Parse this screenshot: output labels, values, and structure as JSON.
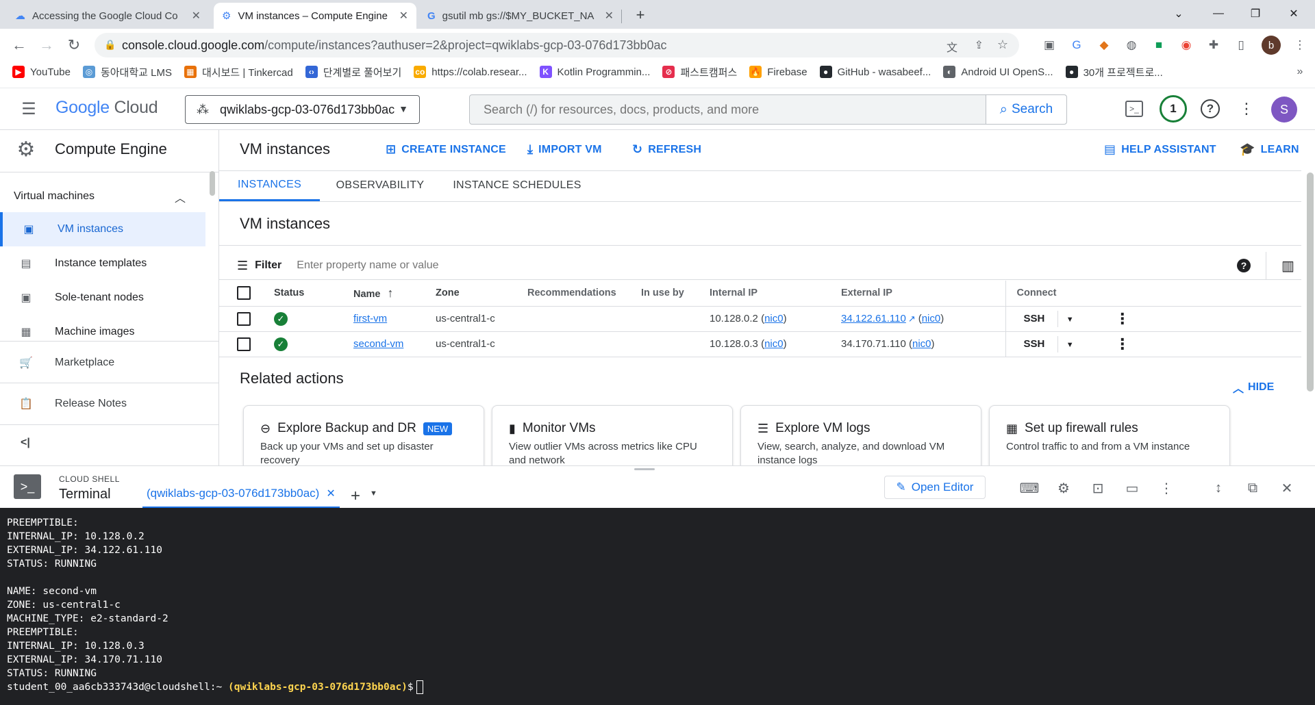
{
  "browser": {
    "tabs": [
      {
        "title": "Accessing the Google Cloud Co",
        "active": false
      },
      {
        "title": "VM instances – Compute Engine",
        "active": true
      },
      {
        "title": "gsutil mb gs://$MY_BUCKET_NA",
        "active": false
      }
    ],
    "new_tab": "+",
    "url_host": "console.cloud.google.com",
    "url_rest": "/compute/instances?authuser=2&project=qwiklabs-gcp-03-076d173bb0ac",
    "profile_initial": "b",
    "bookmarks": [
      {
        "label": "YouTube",
        "color": "#ff0000",
        "glyph": "▶"
      },
      {
        "label": "동아대학교 LMS",
        "color": "#5b9bd5",
        "glyph": "◎"
      },
      {
        "label": "대시보드 | Tinkercad",
        "color": "#e8710a",
        "glyph": "▦"
      },
      {
        "label": "단계별로 풀어보기",
        "color": "#3367d6",
        "glyph": "‹›"
      },
      {
        "label": "https://colab.resear...",
        "color": "#f9ab00",
        "glyph": "co"
      },
      {
        "label": "Kotlin Programmin...",
        "color": "#7f52ff",
        "glyph": "K"
      },
      {
        "label": "패스트캠퍼스",
        "color": "#e52e4d",
        "glyph": "⊘"
      },
      {
        "label": "Firebase",
        "color": "#ffa000",
        "glyph": "🔥"
      },
      {
        "label": "GitHub - wasabeef...",
        "color": "#24292e",
        "glyph": "●"
      },
      {
        "label": "Android UI OpenS...",
        "color": "#5f6368",
        "glyph": "◐"
      },
      {
        "label": "30개 프로젝트로...",
        "color": "#24292e",
        "glyph": "●"
      }
    ],
    "bookmarks_more": "»"
  },
  "gcp": {
    "logo_google": "Google",
    "logo_cloud": "Cloud",
    "project": "qwiklabs-gcp-03-076d173bb0ac",
    "search_placeholder": "Search (/) for resources, docs, products, and more",
    "search_button": "Search",
    "notifications_count": "1",
    "avatar_initial": "S"
  },
  "sidebar": {
    "product_title": "Compute Engine",
    "section": "Virtual machines",
    "items": [
      {
        "label": "VM instances"
      },
      {
        "label": "Instance templates"
      },
      {
        "label": "Sole-tenant nodes"
      },
      {
        "label": "Machine images"
      },
      {
        "label": "Marketplace"
      },
      {
        "label": "Release Notes"
      }
    ],
    "collapse_glyph": "<|"
  },
  "main": {
    "page_title": "VM instances",
    "actions": {
      "create": "CREATE INSTANCE",
      "import": "IMPORT VM",
      "refresh": "REFRESH",
      "help": "HELP ASSISTANT",
      "learn": "LEARN"
    },
    "tabs": [
      "INSTANCES",
      "OBSERVABILITY",
      "INSTANCE SCHEDULES"
    ],
    "section_title": "VM instances",
    "filter_label": "Filter",
    "filter_placeholder": "Enter property name or value",
    "columns": [
      "Status",
      "Name",
      "Zone",
      "Recommendations",
      "In use by",
      "Internal IP",
      "External IP",
      "Connect"
    ],
    "rows": [
      {
        "name": "first-vm",
        "zone": "us-central1-c",
        "internal_ip": "10.128.0.2",
        "nic": "nic0",
        "external_ip": "34.122.61.110",
        "external_linked": true,
        "connect": "SSH"
      },
      {
        "name": "second-vm",
        "zone": "us-central1-c",
        "internal_ip": "10.128.0.3",
        "nic": "nic0",
        "external_ip": "34.170.71.110",
        "external_linked": false,
        "connect": "SSH"
      }
    ],
    "related_title": "Related actions",
    "hide_label": "HIDE",
    "cards": [
      {
        "title": "Explore Backup and DR",
        "badge": "NEW",
        "desc": "Back up your VMs and set up disaster recovery"
      },
      {
        "title": "Monitor VMs",
        "desc": "View outlier VMs across metrics like CPU and network"
      },
      {
        "title": "Explore VM logs",
        "desc": "View, search, analyze, and download VM instance logs"
      },
      {
        "title": "Set up firewall rules",
        "desc": "Control traffic to and from a VM instance"
      }
    ]
  },
  "shell": {
    "label_small": "CLOUD SHELL",
    "label_big": "Terminal",
    "tab_title": "(qwiklabs-gcp-03-076d173bb0ac)",
    "open_editor": "Open Editor",
    "lines": [
      "PREEMPTIBLE:",
      "INTERNAL_IP: 10.128.0.2",
      "EXTERNAL_IP: 34.122.61.110",
      "STATUS: RUNNING",
      "",
      "NAME: second-vm",
      "ZONE: us-central1-c",
      "MACHINE_TYPE: e2-standard-2",
      "PREEMPTIBLE:",
      "INTERNAL_IP: 10.128.0.3",
      "EXTERNAL_IP: 34.170.71.110",
      "STATUS: RUNNING"
    ],
    "prompt_user": "student_00_aa6cb333743d@cloudshell:~",
    "prompt_project": "(qwiklabs-gcp-03-076d173bb0ac)",
    "prompt_symbol": "$"
  }
}
